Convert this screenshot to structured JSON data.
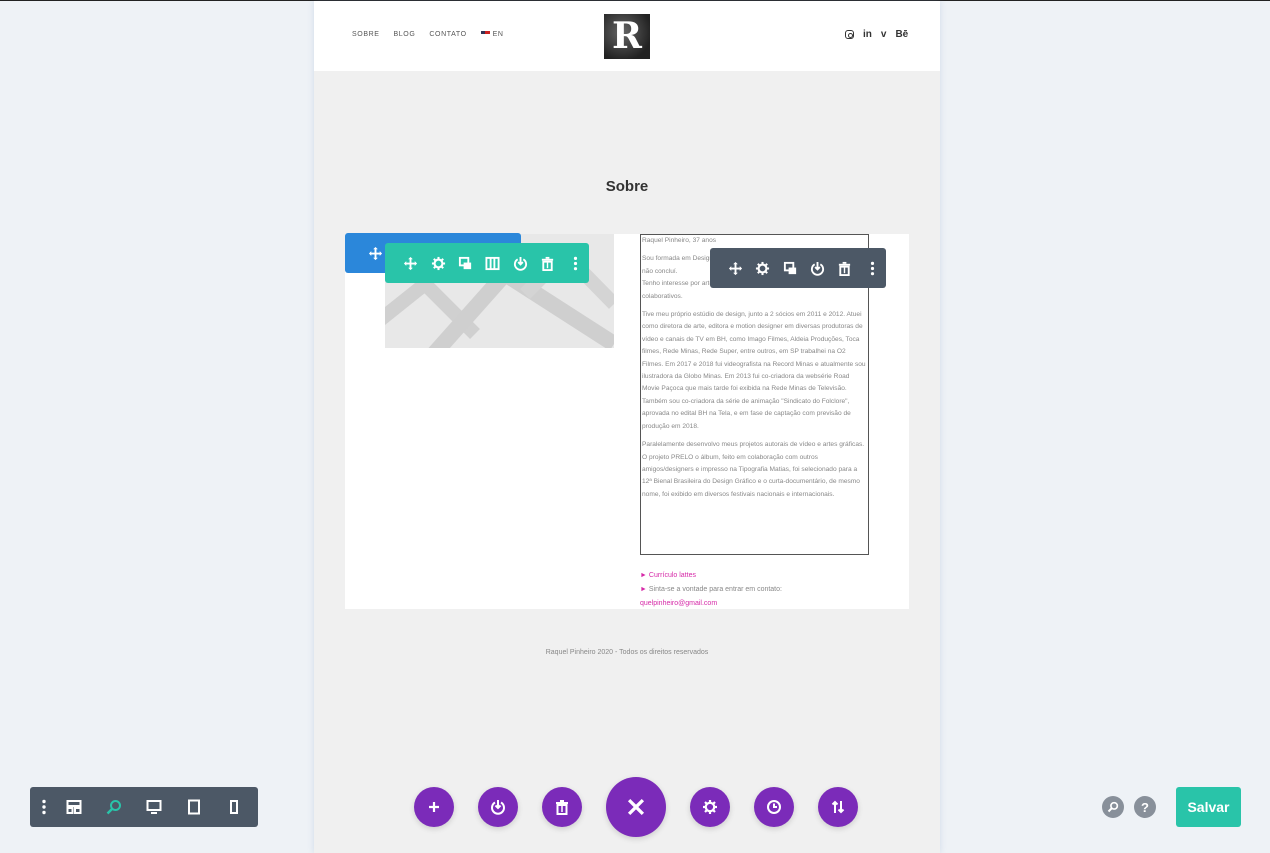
{
  "site": {
    "nav": [
      "SOBRE",
      "BLOG",
      "CONTATO"
    ],
    "lang_label": "EN",
    "logo_letter": "R",
    "social_behance": "Bē",
    "social_linkedin": "in",
    "social_vimeo": "v",
    "section_title": "Sobre",
    "bio_header": "Raquel Pinheiro, 37 anos",
    "bio_p1": "Sou formada em Design especialista em Produção PUC (2013), cursei Artes não concluí.",
    "bio_p1b": "Tenho interesse por artes gráficas, audiovisual e processos criativos e colaborativos.",
    "bio_p2": "Tive meu próprio estúdio de design, junto a 2 sócios em 2011 e 2012. Atuei como diretora de arte, editora e motion designer em diversas produtoras de vídeo e canais de TV em BH, como Imago Filmes, Aldeia Produções, Toca filmes, Rede Minas, Rede Super, entre outros, em SP trabalhei na O2 Filmes. Em 2017 e 2018 fui videografista na Record Minas e atualmente sou ilustradora da Globo Minas. Em 2013 fui co-criadora da websérie Road Movie Paçoca que mais tarde foi exibida na Rede Minas de Televisão. Também sou co-criadora da série de animação \"Sindicato do Folclore\", aprovada no edital BH na Tela, e em fase de captação com previsão de produção em 2018.",
    "bio_p3": "Paralelamente desenvolvo meus projetos autorais de vídeo e artes gráficas. O projeto PRELO o álbum, feito em colaboração com outros amigos/designers e impresso na Tipografia Matias, foi selecionado para a 12ª Bienal Brasileira do Design Gráfico e o curta-documentário, de mesmo nome, foi exibido em diversos festivais nacionais e internacionais.",
    "link_lattes": "Currículo lattes",
    "contact_text": "Sinta-se a vontade para entrar em contato:",
    "contact_email": "quelpinheiro@gmail.com",
    "footer": "Raquel Pinheiro 2020 - Todos os direitos reservados"
  },
  "builder": {
    "save_label": "Salvar",
    "help_label": "?"
  },
  "colors": {
    "row_toolbar": "#2b87da",
    "column_toolbar": "#29c4a9",
    "module_toolbar": "#4c5866",
    "action_purple": "#7b2bb9",
    "save_green": "#29c4a9",
    "link_pink": "#d62aa8"
  }
}
